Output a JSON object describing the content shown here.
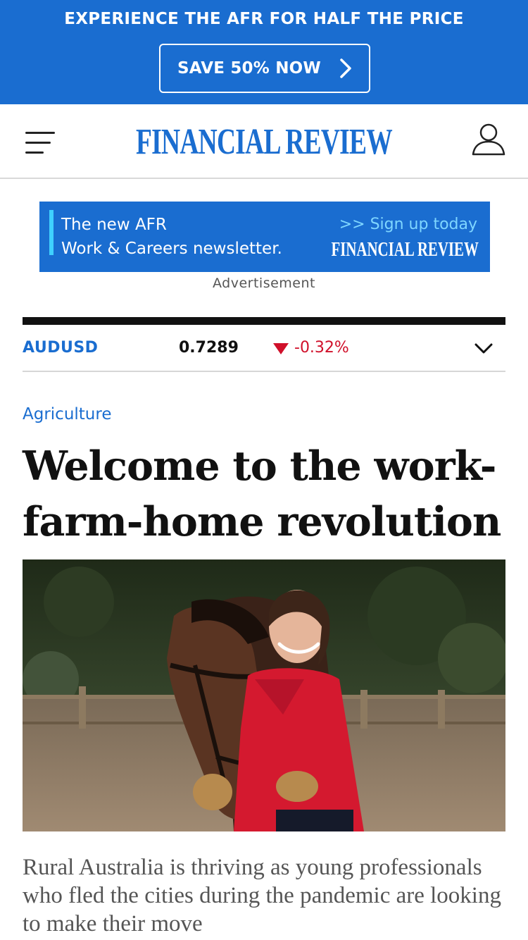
{
  "promo": {
    "title": "EXPERIENCE THE AFR FOR HALF THE PRICE",
    "button_label": "SAVE 50% NOW",
    "button_icon": "chevron-right-icon",
    "background_color": "#1a6dd0"
  },
  "header": {
    "menu_icon": "hamburger-menu-icon",
    "logo_text": "FINANCIAL REVIEW",
    "account_icon": "user-icon",
    "brand_color": "#1a6dd0"
  },
  "ad": {
    "line1": "The new AFR",
    "line2": "Work & Careers newsletter.",
    "cta": ">> Sign up today",
    "logo_text": "FINANCIAL REVIEW",
    "label": "Advertisement"
  },
  "ticker": {
    "symbol": "AUDUSD",
    "price": "0.7289",
    "change": "-0.32%",
    "direction": "down",
    "down_color": "#d0102a"
  },
  "article": {
    "category": "Agriculture",
    "headline": "Welcome to the work-farm-home revolution",
    "image_alt": "Smiling woman in a red shirt standing beside a bay horse in an outdoor riding arena",
    "summary": "Rural Australia is thriving as young professionals who fled the cities during the pandemic are looking to make their move"
  }
}
